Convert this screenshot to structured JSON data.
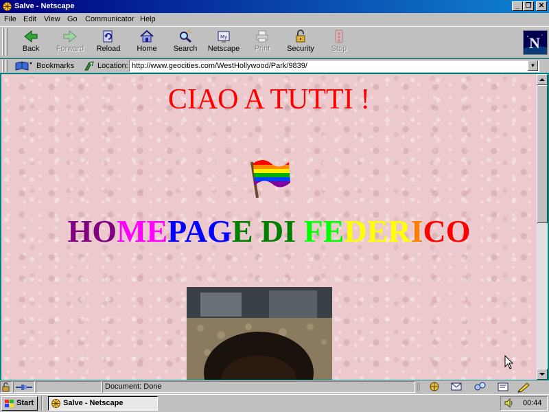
{
  "window": {
    "title": "Salve - Netscape"
  },
  "menu": [
    "File",
    "Edit",
    "View",
    "Go",
    "Communicator",
    "Help"
  ],
  "toolbar": {
    "back": "Back",
    "forward": "Forward",
    "reload": "Reload",
    "home": "Home",
    "search": "Search",
    "netscape": "Netscape",
    "print": "Print",
    "security": "Security",
    "stop": "Stop"
  },
  "location": {
    "bookmarks": "Bookmarks",
    "label": "Location:",
    "url": "http://www.geocities.com/WestHollywood/Park/9839/"
  },
  "page": {
    "greeting": "CIAO A TUTTI !",
    "title_letters": [
      {
        "ch": "H",
        "color": "#800080"
      },
      {
        "ch": "O",
        "color": "#800080"
      },
      {
        "ch": "M",
        "color": "#ff00ff"
      },
      {
        "ch": "E",
        "color": "#ff00ff"
      },
      {
        "ch": "P",
        "color": "#0000ff"
      },
      {
        "ch": "A",
        "color": "#0000ff"
      },
      {
        "ch": "G",
        "color": "#0000ff"
      },
      {
        "ch": "E",
        "color": "#008000"
      },
      {
        "ch": " ",
        "color": "#000000"
      },
      {
        "ch": "D",
        "color": "#008000"
      },
      {
        "ch": "I",
        "color": "#008000"
      },
      {
        "ch": " ",
        "color": "#000000"
      },
      {
        "ch": "F",
        "color": "#00ff00"
      },
      {
        "ch": "E",
        "color": "#00ff00"
      },
      {
        "ch": "D",
        "color": "#ffff00"
      },
      {
        "ch": "E",
        "color": "#ffff00"
      },
      {
        "ch": "R",
        "color": "#ffff00"
      },
      {
        "ch": "I",
        "color": "#ff8000"
      },
      {
        "ch": "C",
        "color": "#ff0000"
      },
      {
        "ch": "O",
        "color": "#ff0000"
      }
    ]
  },
  "status": {
    "text": "Document: Done"
  },
  "taskbar": {
    "start": "Start",
    "task": "Salve - Netscape",
    "clock": "00:44"
  }
}
